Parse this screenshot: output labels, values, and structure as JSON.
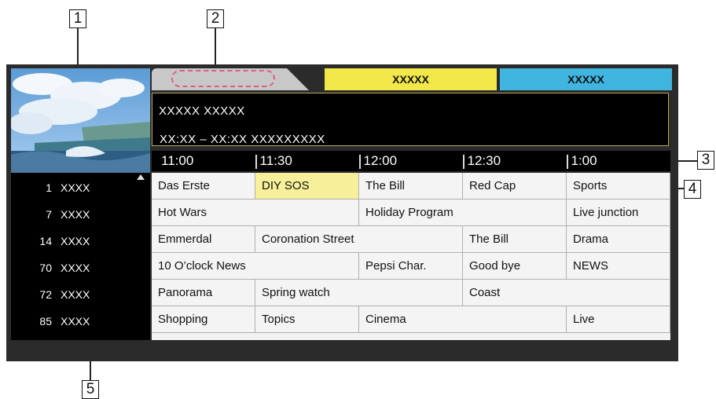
{
  "callouts": [
    "1",
    "2",
    "3",
    "4",
    "5"
  ],
  "tabs": {
    "first": "",
    "yellow": "XXXXX",
    "cyan": "XXXXX"
  },
  "info": {
    "title": "XXXXX  XXXXX",
    "time": "XX:XX – XX:XX  XXXXXXXXX"
  },
  "times": [
    "11:00",
    "11:30",
    "12:00",
    "12:30",
    "1:00"
  ],
  "channels": [
    {
      "num": "1",
      "name": "XXXX"
    },
    {
      "num": "7",
      "name": "XXXX"
    },
    {
      "num": "14",
      "name": "XXXX"
    },
    {
      "num": "70",
      "name": "XXXX"
    },
    {
      "num": "72",
      "name": "XXXX"
    },
    {
      "num": "85",
      "name": "XXXX"
    }
  ],
  "programs": [
    [
      "Das Erste",
      "DIY SOS",
      "The Bill",
      "Red Cap",
      "Sports"
    ],
    [
      "Hot Wars",
      "Holiday Program",
      "Live junction"
    ],
    [
      "Emmerdal",
      "Coronation Street",
      "The Bill",
      "Drama"
    ],
    [
      "10 O’clock News",
      "Pepsi Char.",
      "Good bye",
      "NEWS"
    ],
    [
      "Panorama",
      "Spring watch",
      "Coast"
    ],
    [
      "Shopping",
      "Topics",
      "Cinema",
      "Live"
    ]
  ],
  "colors": {
    "tab_yellow": "#f2e84a",
    "tab_cyan": "#3fb5e0",
    "selected": "#f7ef9a",
    "dash": "#e25a8a"
  }
}
